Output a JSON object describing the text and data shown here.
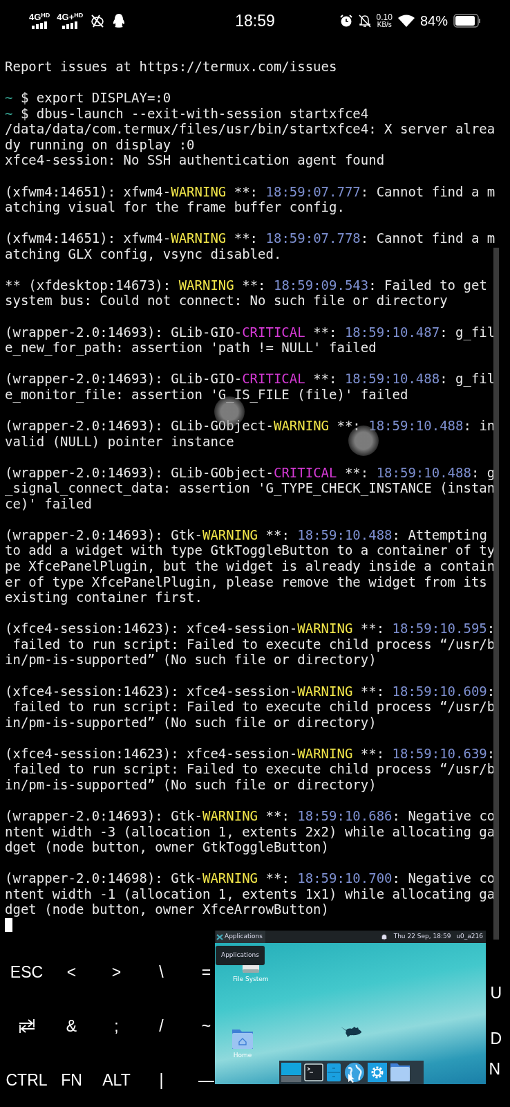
{
  "status_bar": {
    "signals": [
      {
        "label": "4G",
        "sub": "HD"
      },
      {
        "label": "4G+",
        "sub": "HD"
      }
    ],
    "time": "18:59",
    "net_speed": {
      "value": "0.10",
      "unit": "KB/s"
    },
    "battery": "84%"
  },
  "terminal": {
    "cursor_visible": true,
    "lines": [
      {
        "kind": "text",
        "segments": [
          {
            "kind": "plain",
            "text": "Report issues at https://termux.com/issues"
          }
        ]
      },
      {
        "kind": "blank"
      },
      {
        "kind": "text",
        "segments": [
          {
            "kind": "prompt",
            "text": "~"
          },
          {
            "kind": "plain",
            "text": " $ export DISPLAY=:0"
          }
        ]
      },
      {
        "kind": "text",
        "segments": [
          {
            "kind": "prompt",
            "text": "~"
          },
          {
            "kind": "plain",
            "text": " $ dbus-launch --exit-with-session startxfce4"
          }
        ]
      },
      {
        "kind": "text",
        "segments": [
          {
            "kind": "plain",
            "text": "/data/data/com.termux/files/usr/bin/startxfce4: X server alrea"
          }
        ]
      },
      {
        "kind": "text",
        "segments": [
          {
            "kind": "plain",
            "text": "dy running on display :0"
          }
        ]
      },
      {
        "kind": "text",
        "segments": [
          {
            "kind": "plain",
            "text": "xfce4-session: No SSH authentication agent found"
          }
        ]
      },
      {
        "kind": "blank"
      },
      {
        "kind": "text",
        "segments": [
          {
            "kind": "plain",
            "text": "(xfwm4:14651): xfwm4-"
          },
          {
            "kind": "warning",
            "text": "WARNING"
          },
          {
            "kind": "plain",
            "text": " **: "
          },
          {
            "kind": "timestamp",
            "text": "18:59:07.777"
          },
          {
            "kind": "plain",
            "text": ": Cannot find a m"
          }
        ]
      },
      {
        "kind": "text",
        "segments": [
          {
            "kind": "plain",
            "text": "atching visual for the frame buffer config."
          }
        ]
      },
      {
        "kind": "blank"
      },
      {
        "kind": "text",
        "segments": [
          {
            "kind": "plain",
            "text": "(xfwm4:14651): xfwm4-"
          },
          {
            "kind": "warning",
            "text": "WARNING"
          },
          {
            "kind": "plain",
            "text": " **: "
          },
          {
            "kind": "timestamp",
            "text": "18:59:07.778"
          },
          {
            "kind": "plain",
            "text": ": Cannot find a m"
          }
        ]
      },
      {
        "kind": "text",
        "segments": [
          {
            "kind": "plain",
            "text": "atching GLX config, vsync disabled."
          }
        ]
      },
      {
        "kind": "blank"
      },
      {
        "kind": "text",
        "segments": [
          {
            "kind": "plain",
            "text": "** (xfdesktop:14673): "
          },
          {
            "kind": "warning",
            "text": "WARNING"
          },
          {
            "kind": "plain",
            "text": " **: "
          },
          {
            "kind": "timestamp",
            "text": "18:59:09.543"
          },
          {
            "kind": "plain",
            "text": ": Failed to get"
          }
        ]
      },
      {
        "kind": "text",
        "segments": [
          {
            "kind": "plain",
            "text": "system bus: Could not connect: No such file or directory"
          }
        ]
      },
      {
        "kind": "blank"
      },
      {
        "kind": "text",
        "segments": [
          {
            "kind": "plain",
            "text": "(wrapper-2.0:14693): GLib-GIO-"
          },
          {
            "kind": "critical",
            "text": "CRITICAL"
          },
          {
            "kind": "plain",
            "text": " **: "
          },
          {
            "kind": "timestamp",
            "text": "18:59:10.487"
          },
          {
            "kind": "plain",
            "text": ": g_fil"
          }
        ]
      },
      {
        "kind": "text",
        "segments": [
          {
            "kind": "plain",
            "text": "e_new_for_path: assertion 'path != NULL' failed"
          }
        ]
      },
      {
        "kind": "blank"
      },
      {
        "kind": "text",
        "segments": [
          {
            "kind": "plain",
            "text": "(wrapper-2.0:14693): GLib-GIO-"
          },
          {
            "kind": "critical",
            "text": "CRITICAL"
          },
          {
            "kind": "plain",
            "text": " **: "
          },
          {
            "kind": "timestamp",
            "text": "18:59:10.488"
          },
          {
            "kind": "plain",
            "text": ": g_fil"
          }
        ]
      },
      {
        "kind": "text",
        "segments": [
          {
            "kind": "plain",
            "text": "e_monitor_file: assertion 'G_IS_FILE (file)' failed"
          }
        ]
      },
      {
        "kind": "blank"
      },
      {
        "kind": "text",
        "segments": [
          {
            "kind": "plain",
            "text": "(wrapper-2.0:14693): GLib-GObject-"
          },
          {
            "kind": "warning",
            "text": "WARNING"
          },
          {
            "kind": "plain",
            "text": " **: "
          },
          {
            "kind": "timestamp",
            "text": "18:59:10.488"
          },
          {
            "kind": "plain",
            "text": ": in"
          }
        ]
      },
      {
        "kind": "text",
        "segments": [
          {
            "kind": "plain",
            "text": "valid (NULL) pointer instance"
          }
        ]
      },
      {
        "kind": "blank"
      },
      {
        "kind": "text",
        "segments": [
          {
            "kind": "plain",
            "text": "(wrapper-2.0:14693): GLib-GObject-"
          },
          {
            "kind": "critical",
            "text": "CRITICAL"
          },
          {
            "kind": "plain",
            "text": " **: "
          },
          {
            "kind": "timestamp",
            "text": "18:59:10.488"
          },
          {
            "kind": "plain",
            "text": ": g"
          }
        ]
      },
      {
        "kind": "text",
        "segments": [
          {
            "kind": "plain",
            "text": "_signal_connect_data: assertion 'G_TYPE_CHECK_INSTANCE (instan"
          }
        ]
      },
      {
        "kind": "text",
        "segments": [
          {
            "kind": "plain",
            "text": "ce)' failed"
          }
        ]
      },
      {
        "kind": "blank"
      },
      {
        "kind": "text",
        "segments": [
          {
            "kind": "plain",
            "text": "(wrapper-2.0:14693): Gtk-"
          },
          {
            "kind": "warning",
            "text": "WARNING"
          },
          {
            "kind": "plain",
            "text": " **: "
          },
          {
            "kind": "timestamp",
            "text": "18:59:10.488"
          },
          {
            "kind": "plain",
            "text": ": Attempting"
          }
        ]
      },
      {
        "kind": "text",
        "segments": [
          {
            "kind": "plain",
            "text": "to add a widget with type GtkToggleButton to a container of ty"
          }
        ]
      },
      {
        "kind": "text",
        "segments": [
          {
            "kind": "plain",
            "text": "pe XfcePanelPlugin, but the widget is already inside a contain"
          }
        ]
      },
      {
        "kind": "text",
        "segments": [
          {
            "kind": "plain",
            "text": "er of type XfcePanelPlugin, please remove the widget from its"
          }
        ]
      },
      {
        "kind": "text",
        "segments": [
          {
            "kind": "plain",
            "text": "existing container first."
          }
        ]
      },
      {
        "kind": "blank"
      },
      {
        "kind": "text",
        "segments": [
          {
            "kind": "plain",
            "text": "(xfce4-session:14623): xfce4-session-"
          },
          {
            "kind": "warning",
            "text": "WARNING"
          },
          {
            "kind": "plain",
            "text": " **: "
          },
          {
            "kind": "timestamp",
            "text": "18:59:10.595"
          },
          {
            "kind": "plain",
            "text": ":"
          }
        ]
      },
      {
        "kind": "text",
        "segments": [
          {
            "kind": "plain",
            "text": " failed to run script: Failed to execute child process “/usr/b"
          }
        ]
      },
      {
        "kind": "text",
        "segments": [
          {
            "kind": "plain",
            "text": "in/pm-is-supported” (No such file or directory)"
          }
        ]
      },
      {
        "kind": "blank"
      },
      {
        "kind": "text",
        "segments": [
          {
            "kind": "plain",
            "text": "(xfce4-session:14623): xfce4-session-"
          },
          {
            "kind": "warning",
            "text": "WARNING"
          },
          {
            "kind": "plain",
            "text": " **: "
          },
          {
            "kind": "timestamp",
            "text": "18:59:10.609"
          },
          {
            "kind": "plain",
            "text": ":"
          }
        ]
      },
      {
        "kind": "text",
        "segments": [
          {
            "kind": "plain",
            "text": " failed to run script: Failed to execute child process “/usr/b"
          }
        ]
      },
      {
        "kind": "text",
        "segments": [
          {
            "kind": "plain",
            "text": "in/pm-is-supported” (No such file or directory)"
          }
        ]
      },
      {
        "kind": "blank"
      },
      {
        "kind": "text",
        "segments": [
          {
            "kind": "plain",
            "text": "(xfce4-session:14623): xfce4-session-"
          },
          {
            "kind": "warning",
            "text": "WARNING"
          },
          {
            "kind": "plain",
            "text": " **: "
          },
          {
            "kind": "timestamp",
            "text": "18:59:10.639"
          },
          {
            "kind": "plain",
            "text": ":"
          }
        ]
      },
      {
        "kind": "text",
        "segments": [
          {
            "kind": "plain",
            "text": " failed to run script: Failed to execute child process “/usr/b"
          }
        ]
      },
      {
        "kind": "text",
        "segments": [
          {
            "kind": "plain",
            "text": "in/pm-is-supported” (No such file or directory)"
          }
        ]
      },
      {
        "kind": "blank"
      },
      {
        "kind": "text",
        "segments": [
          {
            "kind": "plain",
            "text": "(wrapper-2.0:14693): Gtk-"
          },
          {
            "kind": "warning",
            "text": "WARNING"
          },
          {
            "kind": "plain",
            "text": " **: "
          },
          {
            "kind": "timestamp",
            "text": "18:59:10.686"
          },
          {
            "kind": "plain",
            "text": ": Negative co"
          }
        ]
      },
      {
        "kind": "text",
        "segments": [
          {
            "kind": "plain",
            "text": "ntent width -3 (allocation 1, extents 2x2) while allocating ga"
          }
        ]
      },
      {
        "kind": "text",
        "segments": [
          {
            "kind": "plain",
            "text": "dget (node button, owner GtkToggleButton)"
          }
        ]
      },
      {
        "kind": "blank"
      },
      {
        "kind": "text",
        "segments": [
          {
            "kind": "plain",
            "text": "(wrapper-2.0:14698): Gtk-"
          },
          {
            "kind": "warning",
            "text": "WARNING"
          },
          {
            "kind": "plain",
            "text": " **: "
          },
          {
            "kind": "timestamp",
            "text": "18:59:10.700"
          },
          {
            "kind": "plain",
            "text": ": Negative co"
          }
        ]
      },
      {
        "kind": "text",
        "segments": [
          {
            "kind": "plain",
            "text": "ntent width -1 (allocation 1, extents 1x1) while allocating ga"
          }
        ]
      },
      {
        "kind": "text",
        "segments": [
          {
            "kind": "plain",
            "text": "dget (node button, owner XfceArrowButton)"
          }
        ]
      }
    ]
  },
  "extra_keys": {
    "rows": [
      [
        {
          "kind": "text",
          "label": "ESC"
        },
        {
          "kind": "text",
          "label": "<"
        },
        {
          "kind": "text",
          "label": ">"
        },
        {
          "kind": "text",
          "label": "\\"
        },
        {
          "kind": "text",
          "label": "="
        }
      ],
      [
        {
          "kind": "tab"
        },
        {
          "kind": "text",
          "label": "&"
        },
        {
          "kind": "text",
          "label": ";"
        },
        {
          "kind": "text",
          "label": "/"
        },
        {
          "kind": "text",
          "label": "~"
        }
      ],
      [
        {
          "kind": "text",
          "label": "CTRL"
        },
        {
          "kind": "text",
          "label": "FN"
        },
        {
          "kind": "text",
          "label": "ALT"
        },
        {
          "kind": "text",
          "label": "|"
        },
        {
          "kind": "text",
          "label": "—"
        }
      ]
    ],
    "right_fragments": [
      "U",
      "D",
      "N"
    ]
  },
  "desktop_preview": {
    "panel": {
      "menu_label": "Applications",
      "clock": "Thu 22 Sep, 18:59",
      "user": "u0_a216"
    },
    "tooltip": "Applications",
    "icons": [
      {
        "kind": "drive",
        "label": "File System"
      },
      {
        "kind": "home",
        "label": "Home"
      }
    ]
  }
}
